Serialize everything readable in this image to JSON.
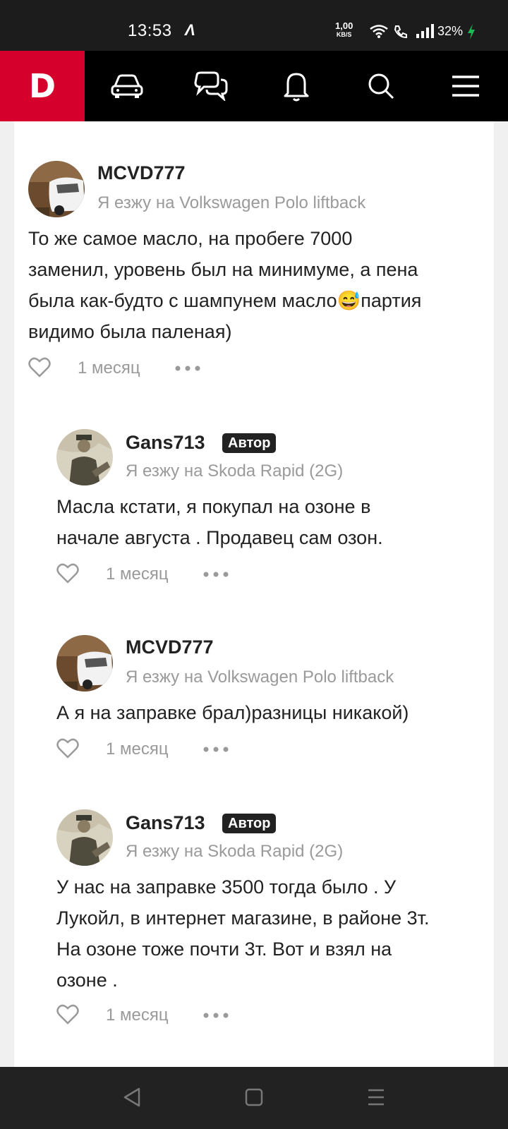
{
  "status": {
    "time": "13:53",
    "speed": "1,00",
    "speed_unit": "KB/S",
    "battery": "32%"
  },
  "nav": {
    "logo": "D",
    "icons": [
      "car-icon",
      "chat-icon",
      "bell-icon",
      "search-icon",
      "menu-icon"
    ]
  },
  "comments": [
    {
      "user": "MCVD777",
      "car": "Я езжу на Volkswagen Polo liftback",
      "text_lines": [
        "То же самое масло, на пробеге 7000",
        "заменил, уровень был на минимуме, а пена",
        "была как-будто с шампунем масло😅партия",
        "видимо была паленая)"
      ],
      "time": "1 месяц",
      "avatar": "white-car-avatar"
    },
    {
      "user": "Gans713",
      "badge": "Автор",
      "car": "Я езжу на Skoda Rapid (2G)",
      "text_lines": [
        "Масла кстати, я покупал на озоне в",
        "начале августа . Продавец сам озон."
      ],
      "time": "1 месяц",
      "avatar": "soldier-photo-avatar"
    },
    {
      "user": "MCVD777",
      "car": "Я езжу на Volkswagen Polo liftback",
      "text_lines": [
        "А я на заправке брал)разницы никакой)"
      ],
      "time": "1 месяц",
      "avatar": "white-car-avatar"
    },
    {
      "user": "Gans713",
      "badge": "Автор",
      "car": "Я езжу на Skoda Rapid (2G)",
      "text_lines": [
        "У нас на заправке 3500 тогда было . У",
        "Лукойл, в интернет магазине, в районе 3т.",
        "На озоне тоже почти 3т. Вот и взял на",
        "озоне ."
      ],
      "time": "1 месяц",
      "avatar": "soldier-photo-avatar"
    }
  ],
  "colors": {
    "brand": "#d5002c",
    "nav_bg": "#000000",
    "muted": "#9a9a9a"
  }
}
